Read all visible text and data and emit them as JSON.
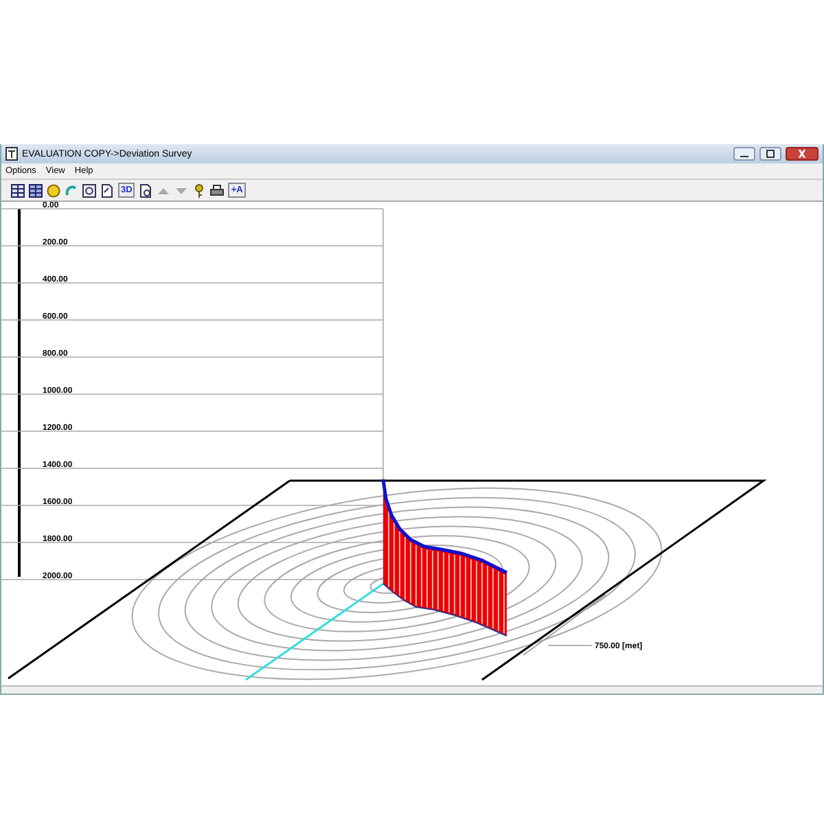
{
  "window": {
    "title": "EVALUATION COPY->Deviation Survey"
  },
  "menu": [
    "Options",
    "View",
    "Help"
  ],
  "toolbar": [
    {
      "kind": "table",
      "disabled": false
    },
    {
      "kind": "table-blue",
      "disabled": false
    },
    {
      "kind": "smiley",
      "disabled": false
    },
    {
      "kind": "curve",
      "disabled": false
    },
    {
      "kind": "zoom",
      "disabled": false
    },
    {
      "kind": "page",
      "disabled": false
    },
    {
      "kind": "text",
      "label": "3D",
      "disabled": false
    },
    {
      "kind": "preview",
      "disabled": false
    },
    {
      "kind": "up",
      "disabled": true
    },
    {
      "kind": "down",
      "disabled": true
    },
    {
      "kind": "key",
      "disabled": false
    },
    {
      "kind": "printer",
      "disabled": false
    },
    {
      "kind": "text",
      "label": "+A",
      "disabled": false
    }
  ],
  "plot": {
    "depth_labels": [
      "0.00",
      "200.00",
      "400.00",
      "600.00",
      "800.00",
      "1000.00",
      "1200.00",
      "1400.00",
      "1600.00",
      "1800.00",
      "2000.00"
    ],
    "scale_label": "750.00 [met]"
  }
}
